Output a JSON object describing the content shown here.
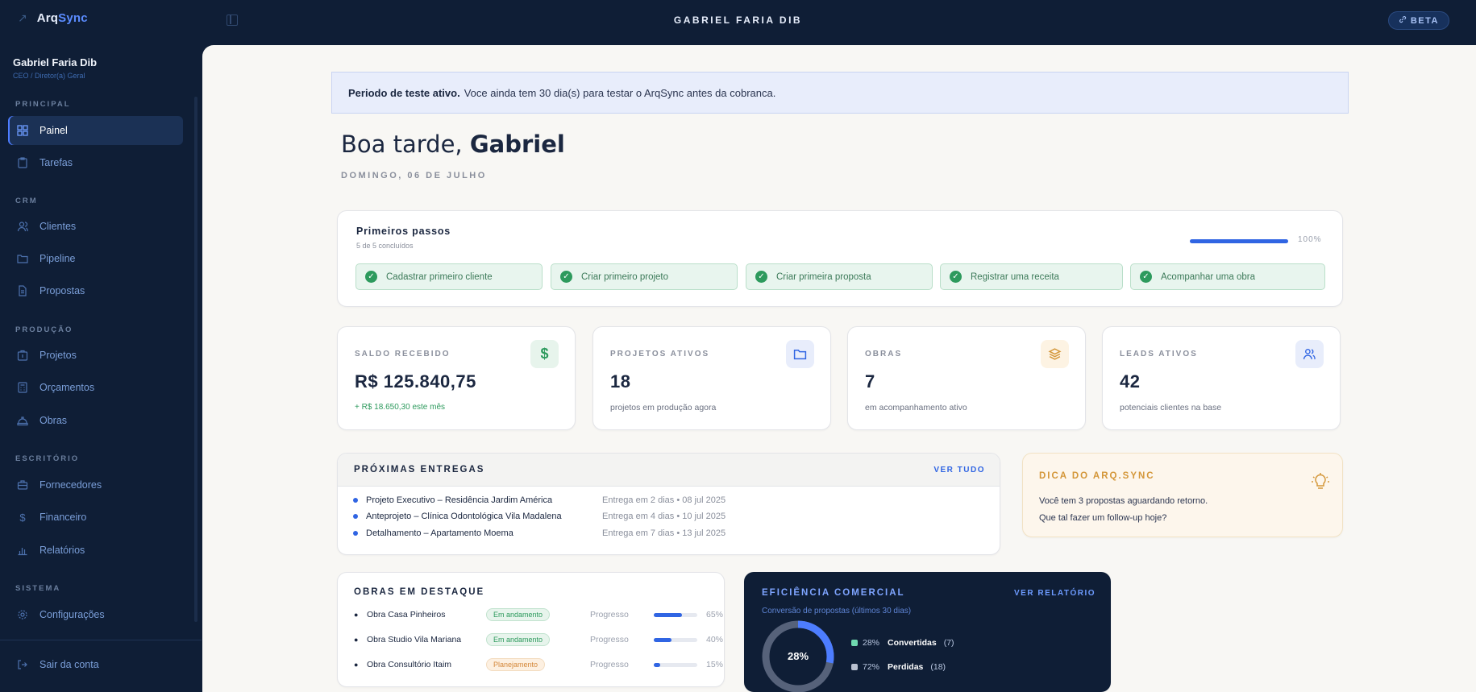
{
  "app": {
    "name_prefix": "Arq",
    "name_suffix": "Sync",
    "title": "GABRIEL FARIA DIB",
    "beta_label": "BETA"
  },
  "user": {
    "name": "Gabriel Faria Dib",
    "role": "CEO / Diretor(a) Geral"
  },
  "sidebar": {
    "sections": {
      "principal": "PRINCIPAL",
      "crm": "CRM",
      "producao": "PRODUÇÃO",
      "escritorio": "ESCRITÓRIO",
      "sistema": "SISTEMA"
    },
    "items": {
      "painel": "Painel",
      "tarefas": "Tarefas",
      "clientes": "Clientes",
      "pipeline": "Pipeline",
      "propostas": "Propostas",
      "projetos": "Projetos",
      "orcamentos": "Orçamentos",
      "obras": "Obras",
      "fornecedores": "Fornecedores",
      "financeiro": "Financeiro",
      "relatorios": "Relatórios",
      "configuracoes": "Configurações"
    },
    "logout": "Sair da conta"
  },
  "trial": {
    "bold": "Periodo de teste ativo.",
    "text": "Voce ainda tem 30 dia(s) para testar o ArqSync antes da cobranca."
  },
  "greeting": {
    "prefix": "Boa tarde,",
    "name": "Gabriel",
    "date": "DOMINGO, 06 DE JULHO"
  },
  "onboarding": {
    "title": "Primeiros passos",
    "subtitle": "5 de 5 concluídos",
    "progress": 1.0,
    "progress_label": "100%",
    "steps": [
      "Cadastrar primeiro cliente",
      "Criar primeiro projeto",
      "Criar primeira proposta",
      "Registrar uma receita",
      "Acompanhar uma obra"
    ]
  },
  "stats": [
    {
      "label": "SALDO RECEBIDO",
      "value": "R$ 125.840,75",
      "sub": "+ R$ 18.650,30 este mês",
      "icon": "dollar-icon",
      "color": "#2d9a5d"
    },
    {
      "label": "PROJETOS ATIVOS",
      "value": "18",
      "sub": "projetos em produção agora",
      "icon": "folder-icon",
      "color": "#3065e3"
    },
    {
      "label": "OBRAS",
      "value": "7",
      "sub": "em acompanhamento ativo",
      "icon": "layers-icon",
      "color": "#d4973a"
    },
    {
      "label": "LEADS ATIVOS",
      "value": "42",
      "sub": "potenciais clientes na base",
      "icon": "users-icon",
      "color": "#3065e3"
    }
  ],
  "deliveries": {
    "title": "PRÓXIMAS ENTREGAS",
    "link": "VER TUDO",
    "rows": [
      {
        "project": "Projeto Executivo – Residência Jardim América",
        "due": "Entrega em 2 dias • 08 jul 2025"
      },
      {
        "project": "Anteprojeto – Clínica Odontológica Vila Madalena",
        "due": "Entrega em 4 dias • 10 jul 2025"
      },
      {
        "project": "Detalhamento – Apartamento Moema",
        "due": "Entrega em 7 dias • 13 jul 2025"
      }
    ]
  },
  "tip": {
    "title": "DICA DO ARQ.SYNC",
    "line1": "Você tem 3 propostas aguardando retorno.",
    "line2": "Que tal fazer um follow-up hoje?"
  },
  "works": {
    "title": "OBRAS EM DESTAQUE",
    "progress_label": "Progresso",
    "rows": [
      {
        "name": "Obra Casa Pinheiros",
        "status": "Em andamento",
        "progress": 65,
        "progress_text": "65%"
      },
      {
        "name": "Obra Studio Vila Mariana",
        "status": "Em andamento",
        "progress": 40,
        "progress_text": "40%"
      },
      {
        "name": "Obra Consultório Itaim",
        "status": "Planejamento",
        "progress": 15,
        "progress_text": "15%"
      }
    ]
  },
  "efficiency": {
    "title": "EFICIÊNCIA COMERCIAL",
    "link": "VER RELATÓRIO",
    "subtitle": "Conversão de propostas (últimos 30 dias)",
    "center": "28%",
    "converted": {
      "pct": "28%",
      "label": "Convertidas",
      "count": "(7)",
      "value": 28,
      "color": "#4d7dff"
    },
    "lost": {
      "pct": "72%",
      "label": "Perdidas",
      "count": "(18)",
      "value": 72,
      "color": "#56627a"
    }
  }
}
